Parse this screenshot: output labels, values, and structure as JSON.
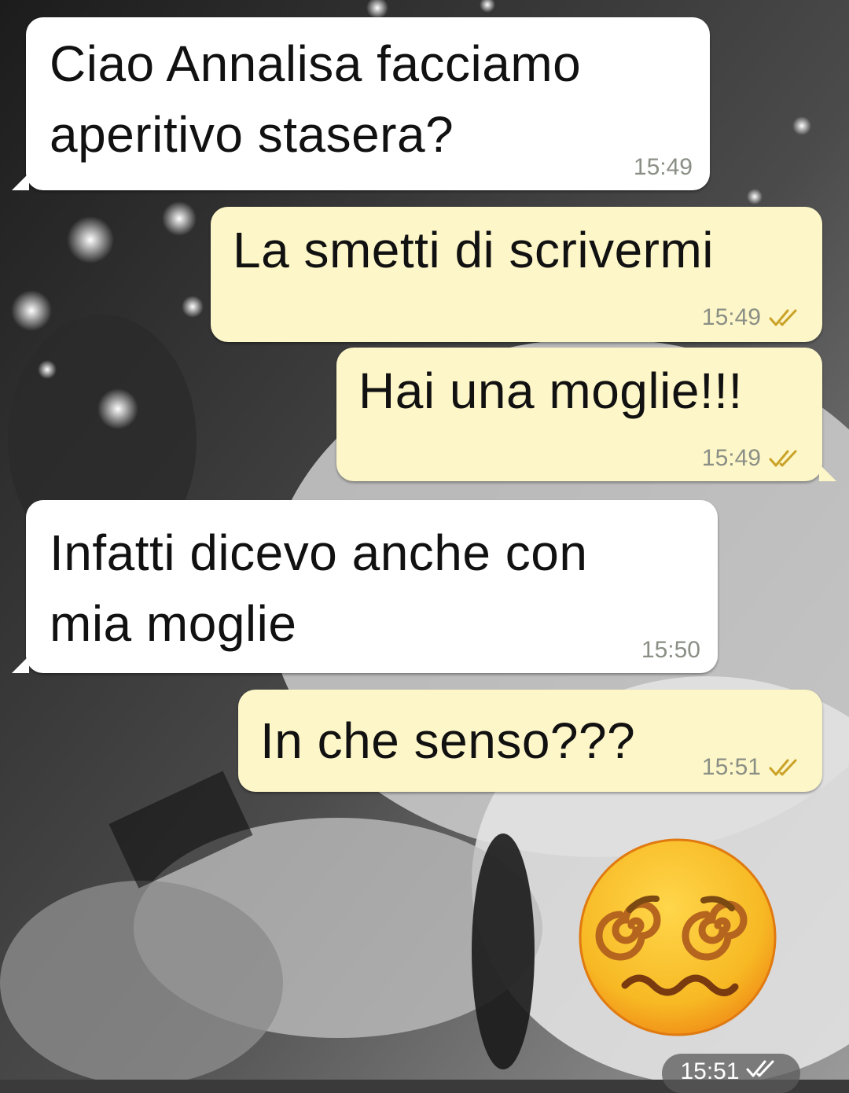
{
  "chat": {
    "messages": [
      {
        "direction": "incoming",
        "text": "Ciao Annalisa facciamo\naperitivo stasera?",
        "time": "15:49"
      },
      {
        "direction": "outgoing",
        "text": "La smetti di scrivermi",
        "time": "15:49",
        "status": "read"
      },
      {
        "direction": "outgoing",
        "text": "Hai una moglie!!!",
        "time": "15:49",
        "status": "read"
      },
      {
        "direction": "incoming",
        "text": "Infatti dicevo anche con\nmia moglie",
        "time": "15:50"
      },
      {
        "direction": "outgoing",
        "text": "In che senso???",
        "time": "15:51",
        "status": "read"
      },
      {
        "direction": "outgoing",
        "emoji": "face-with-spiral-eyes",
        "time": "15:51",
        "status": "read"
      }
    ]
  },
  "colors": {
    "incoming_bubble": "#ffffff",
    "outgoing_bubble": "#fdf6c8",
    "timestamp": "#8a8f85",
    "read_ticks": "#c9a227",
    "emoji_face": "#f7b924"
  },
  "icons": {
    "read_receipt": "double-check-icon",
    "sticker": "spiral-eyes-emoji"
  }
}
